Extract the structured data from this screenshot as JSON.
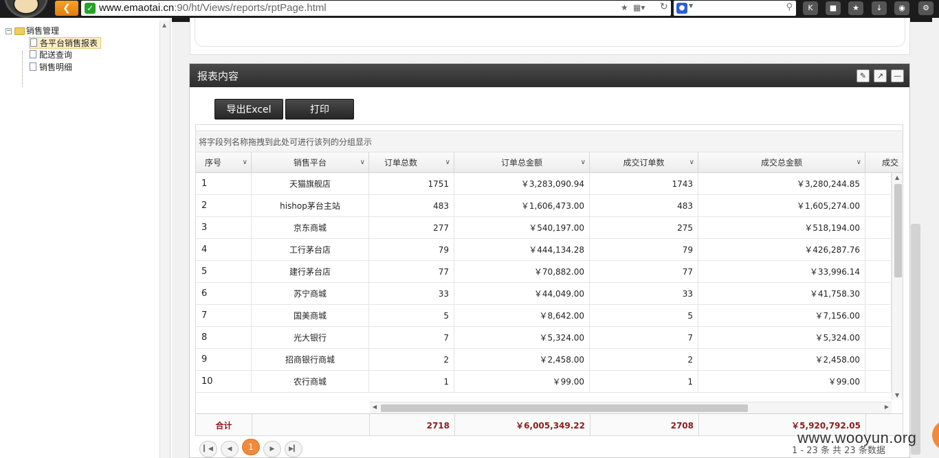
{
  "browser": {
    "url_host": "www.emaotai.cn",
    "url_rest": ":90/ht/Views/reports/rptPage.html"
  },
  "tree": {
    "root_label": "销售管理",
    "items": [
      {
        "label": "各平台销售报表",
        "selected": true
      },
      {
        "label": "配送查询",
        "selected": false
      },
      {
        "label": "销售明细",
        "selected": false
      }
    ]
  },
  "panel": {
    "title": "报表内容",
    "export_label": "导出Excel",
    "print_label": "打印"
  },
  "grid": {
    "grouping_hint": "将字段列名称拖拽到此处可进行该列的分组显示",
    "columns": [
      "序号",
      "销售平台",
      "订单总数",
      "订单总金额",
      "成交订单数",
      "成交总金额",
      "成交"
    ],
    "rows": [
      {
        "no": "1",
        "platform": "天猫旗舰店",
        "orders": "1751",
        "order_amount": "￥3,283,090.94",
        "deals": "1743",
        "deal_amount": "￥3,280,244.85"
      },
      {
        "no": "2",
        "platform": "hishop茅台主站",
        "orders": "483",
        "order_amount": "￥1,606,473.00",
        "deals": "483",
        "deal_amount": "￥1,605,274.00"
      },
      {
        "no": "3",
        "platform": "京东商城",
        "orders": "277",
        "order_amount": "￥540,197.00",
        "deals": "275",
        "deal_amount": "￥518,194.00"
      },
      {
        "no": "4",
        "platform": "工行茅台店",
        "orders": "79",
        "order_amount": "￥444,134.28",
        "deals": "79",
        "deal_amount": "￥426,287.76"
      },
      {
        "no": "5",
        "platform": "建行茅台店",
        "orders": "77",
        "order_amount": "￥70,882.00",
        "deals": "77",
        "deal_amount": "￥33,996.14"
      },
      {
        "no": "6",
        "platform": "苏宁商城",
        "orders": "33",
        "order_amount": "￥44,049.00",
        "deals": "33",
        "deal_amount": "￥41,758.30"
      },
      {
        "no": "7",
        "platform": "国美商城",
        "orders": "5",
        "order_amount": "￥8,642.00",
        "deals": "5",
        "deal_amount": "￥7,156.00"
      },
      {
        "no": "8",
        "platform": "光大银行",
        "orders": "7",
        "order_amount": "￥5,324.00",
        "deals": "7",
        "deal_amount": "￥5,324.00"
      },
      {
        "no": "9",
        "platform": "招商银行商城",
        "orders": "2",
        "order_amount": "￥2,458.00",
        "deals": "2",
        "deal_amount": "￥2,458.00"
      },
      {
        "no": "10",
        "platform": "农行商城",
        "orders": "1",
        "order_amount": "￥99.00",
        "deals": "1",
        "deal_amount": "￥99.00"
      }
    ],
    "footer": {
      "label": "合计",
      "orders": "2718",
      "order_amount": "￥6,005,349.22",
      "deals": "2708",
      "deal_amount": "￥5,920,792.05"
    }
  },
  "pager": {
    "current_page": "1",
    "info": "1 - 23 条   共 23 条数据"
  },
  "watermark": "www.wooyun.org",
  "icons": [
    "back-arrow-icon",
    "secure-check-icon",
    "star-icon",
    "qr-icon",
    "refresh-icon",
    "baidu-paw-icon",
    "search-icon",
    "k-icon",
    "lock-icon",
    "bookmark-star-icon",
    "download-icon",
    "gamepad-icon",
    "eraser-icon",
    "popout-icon",
    "minimize-icon",
    "chevron-down-icon",
    "first-page-icon",
    "prev-page-icon",
    "next-page-icon",
    "last-page-icon"
  ]
}
